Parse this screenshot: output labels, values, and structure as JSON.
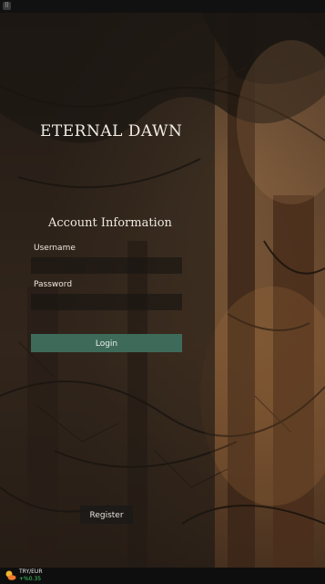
{
  "game": {
    "title": "ETERNAL DAWN"
  },
  "form": {
    "section_title": "Account Information",
    "username_label": "Username",
    "username_value": "",
    "password_label": "Password",
    "password_value": "",
    "login_label": "Login",
    "register_label": "Register"
  },
  "taskbar": {
    "ticker_pair": "TRY/EUR",
    "ticker_change": "+%0.35",
    "ticker_icon": "weather-sun-cloud-icon"
  },
  "colors": {
    "login_button": "#3e6a5a",
    "ticker_positive": "#3fcf6a"
  }
}
